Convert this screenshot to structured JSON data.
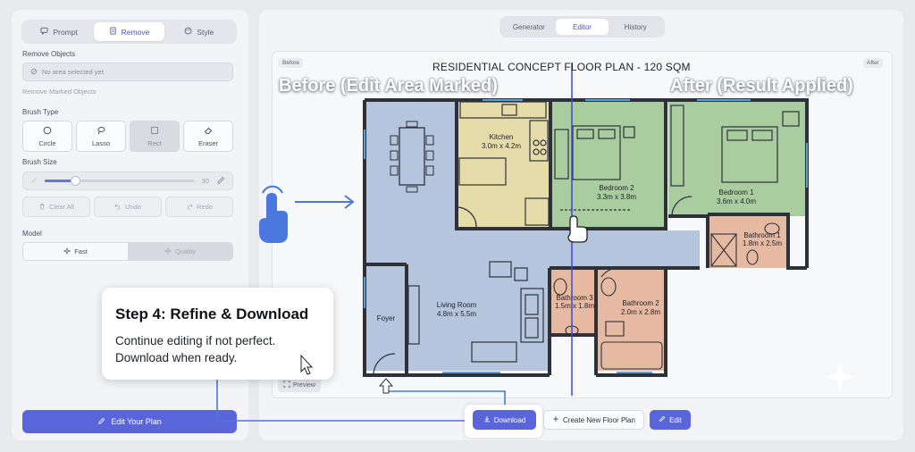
{
  "left_panel": {
    "tabs": [
      {
        "label": "Prompt",
        "icon": "chat-icon"
      },
      {
        "label": "Remove",
        "icon": "eraser-doc-icon"
      },
      {
        "label": "Style",
        "icon": "palette-icon"
      }
    ],
    "remove_objects_label": "Remove Objects",
    "no_area_text": "No area selected yet.",
    "remove_marked_label": "Remove Marked Objects",
    "brush_type_label": "Brush Type",
    "brushes": [
      {
        "label": "Circle",
        "icon": "circle-icon"
      },
      {
        "label": "Lasso",
        "icon": "lasso-icon"
      },
      {
        "label": "Rect",
        "icon": "square-icon"
      },
      {
        "label": "Eraser",
        "icon": "eraser-icon"
      }
    ],
    "brush_size_label": "Brush Size",
    "brush_size_value": "30",
    "brush_size_fraction": 0.2,
    "actions": [
      {
        "label": "Clear All",
        "icon": "trash-icon"
      },
      {
        "label": "Undo",
        "icon": "undo-icon"
      },
      {
        "label": "Redo",
        "icon": "redo-icon"
      }
    ],
    "model_label": "Model",
    "model_options": [
      {
        "label": "Fast",
        "icon": "sparkle-icon"
      },
      {
        "label": "Quality",
        "icon": "sparkle-icon"
      }
    ],
    "edit_plan_label": "Edit Your Plan"
  },
  "right_panel": {
    "tabs": [
      "Generator",
      "Editor",
      "History"
    ],
    "active_tab": "Editor",
    "before_tag": "Before",
    "after_tag": "After",
    "plan_title": "RESIDENTIAL CONCEPT FLOOR PLAN - 120 SQM",
    "before_heading": "Before (Edit Area Marked)",
    "after_heading": "After (Result Applied)",
    "preview_label": "Preview",
    "download_label": "Download",
    "new_plan_label": "Create New Floor Plan",
    "edit_label": "Edit"
  },
  "rooms": {
    "kitchen": {
      "name": "Kitchen",
      "size": "3.0m x 4.2m"
    },
    "bedroom2": {
      "name": "Bedroom 2",
      "size": "3.3m x 3.8m"
    },
    "bedroom1": {
      "name": "Bedroom 1",
      "size": "3.6m x 4.0m"
    },
    "bathroom1": {
      "name": "Bathroom 1",
      "size": "1.8m x 2.5m"
    },
    "bathroom3": {
      "name": "Bathroom 3",
      "size": "1.5m x 1.8m"
    },
    "bathroom2": {
      "name": "Bathroom 2",
      "size": "2.0m x 2.8m"
    },
    "living": {
      "name": "Living Room",
      "size": "4.8m x 5.5m"
    },
    "foyer": {
      "name": "Foyer"
    }
  },
  "callout": {
    "title": "Step 4: Refine & Download",
    "line1": "Continue editing if not perfect.",
    "line2": "Download when ready."
  },
  "colors": {
    "accent": "#5a65da",
    "living_area": "#b6c5de",
    "kitchen": "#e6dcaa",
    "bedrooms": "#a9cd9f",
    "bathrooms": "#e5b9a2"
  }
}
